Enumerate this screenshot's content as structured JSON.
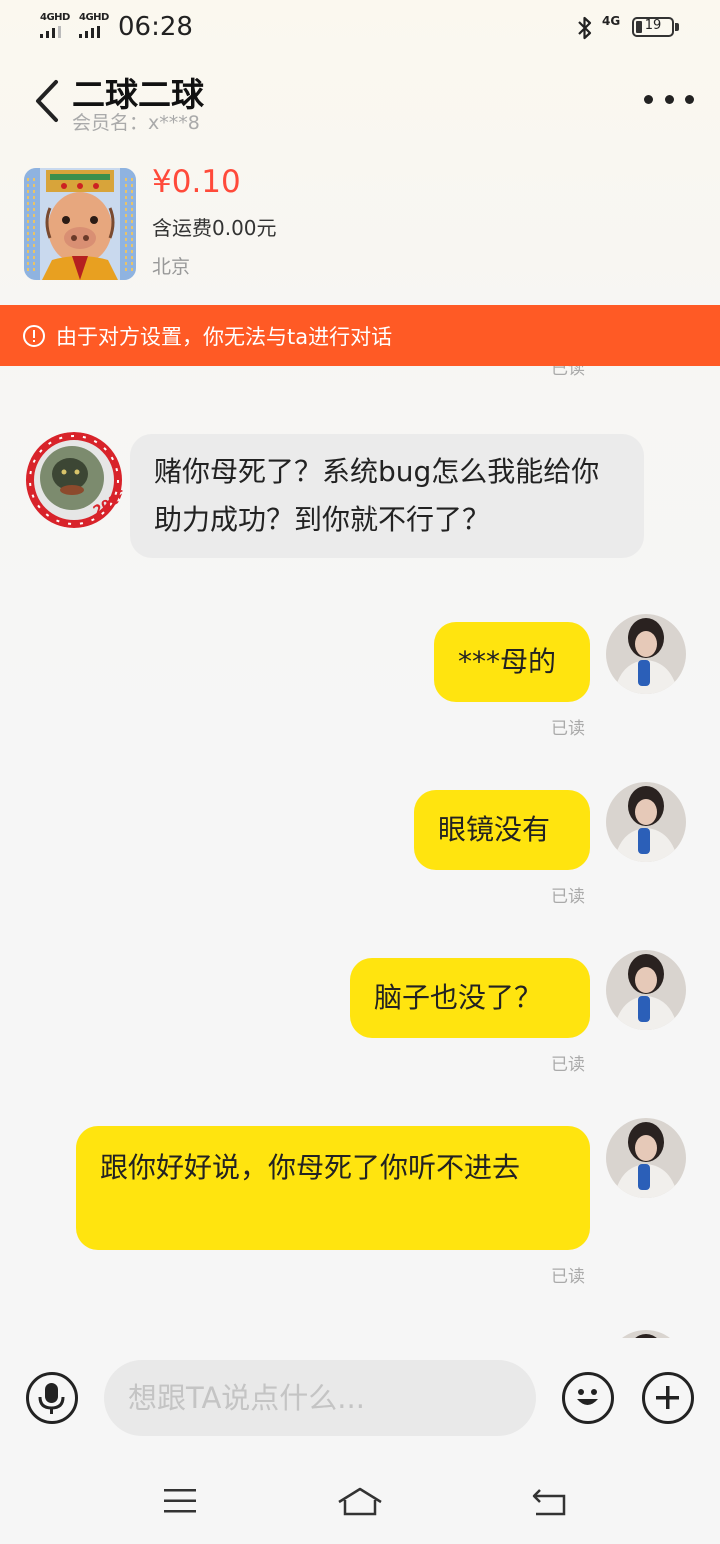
{
  "status_bar": {
    "sim1_label": "4GHD",
    "sim2_label": "4GHD",
    "time": "06:28",
    "network": "4G",
    "battery_level": "19"
  },
  "header": {
    "title": "二球二球",
    "member_label": "会员名：x***8"
  },
  "product": {
    "price": "¥0.10",
    "shipping": "含运费0.00元",
    "location": "北京"
  },
  "banner": {
    "text": "由于对方设置，你无法与ta进行对话",
    "color": "#ff5a25"
  },
  "messages": [
    {
      "side": "incoming",
      "text": "赌你母死了？系统bug怎么我能给你助力成功？到你就不行了？"
    },
    {
      "side": "outgoing",
      "text": "***母的",
      "status": "已读"
    },
    {
      "side": "outgoing",
      "text": "眼镜没有",
      "status": "已读"
    },
    {
      "side": "outgoing",
      "text": "脑子也没了？",
      "status": "已读"
    },
    {
      "side": "outgoing",
      "text": "跟你好好说，你母死了你听不进去",
      "status": "已读"
    }
  ],
  "read_status_top": "已读",
  "input": {
    "placeholder": "想跟TA说点什么..."
  },
  "colors": {
    "outgoing_bubble": "#ffe40f",
    "incoming_bubble": "#ebebeb",
    "price": "#ff4a3a"
  }
}
